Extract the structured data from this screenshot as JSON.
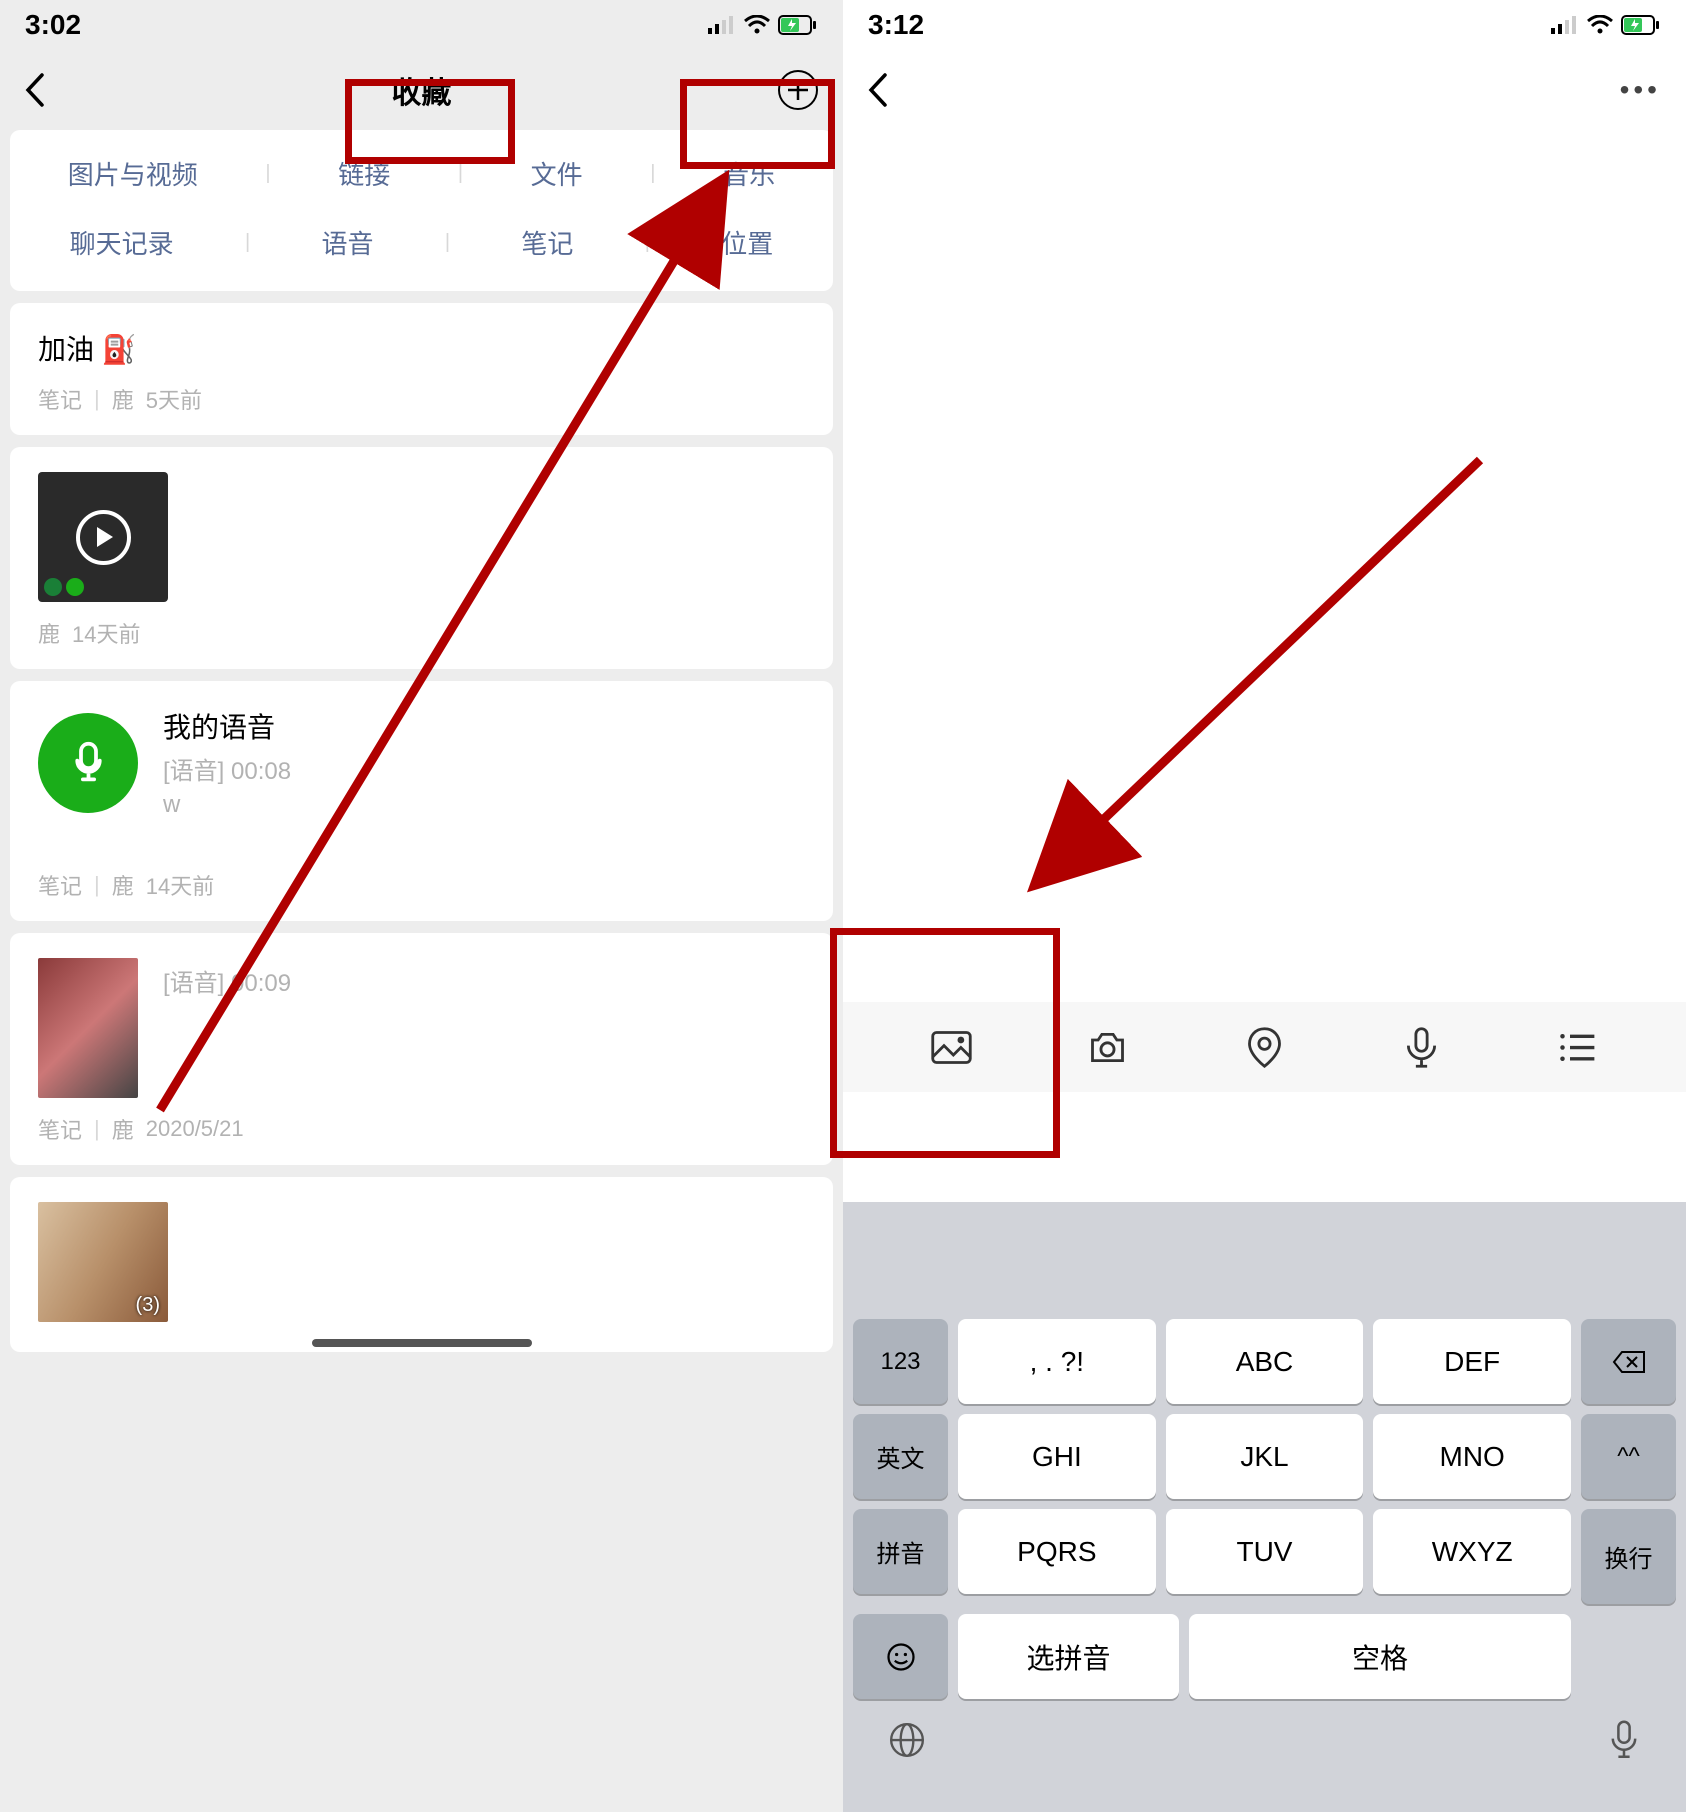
{
  "left": {
    "status_time": "3:02",
    "nav": {
      "title": "收藏"
    },
    "categories": {
      "row1": [
        "图片与视频",
        "链接",
        "文件",
        "音乐"
      ],
      "row2": [
        "聊天记录",
        "语音",
        "笔记",
        "位置"
      ]
    },
    "items": [
      {
        "title": "加油 ⛽",
        "meta_type": "笔记",
        "meta_author": "鹿",
        "meta_time": "5天前"
      },
      {
        "kind": "video",
        "meta_author": "鹿",
        "meta_time": "14天前"
      },
      {
        "kind": "voice",
        "voice_name": "我的语音",
        "voice_tag": "[语音]",
        "voice_dur": "00:08",
        "voice_from": "w",
        "meta_type": "笔记",
        "meta_author": "鹿",
        "meta_time": "14天前"
      },
      {
        "kind": "photo_voice",
        "voice_tag": "[语音]",
        "voice_dur": "00:09",
        "meta_type": "笔记",
        "meta_author": "鹿",
        "meta_time": "2020/5/21"
      },
      {
        "kind": "photo_multi",
        "count": "(3)"
      }
    ]
  },
  "right": {
    "status_time": "3:12",
    "toolbar": {
      "photo": "photo-icon",
      "camera": "camera-icon",
      "location": "location-icon",
      "mic": "microphone-icon",
      "list": "list-icon"
    },
    "keyboard": {
      "r1": [
        "123",
        ", . ?!",
        "ABC",
        "DEF",
        "⌫"
      ],
      "r2": [
        "英文",
        "GHI",
        "JKL",
        "MNO",
        "^^"
      ],
      "r3": [
        "拼音",
        "PQRS",
        "TUV",
        "WXYZ"
      ],
      "r4": [
        "☺",
        "选拼音",
        "空格"
      ],
      "enter": "换行"
    }
  }
}
